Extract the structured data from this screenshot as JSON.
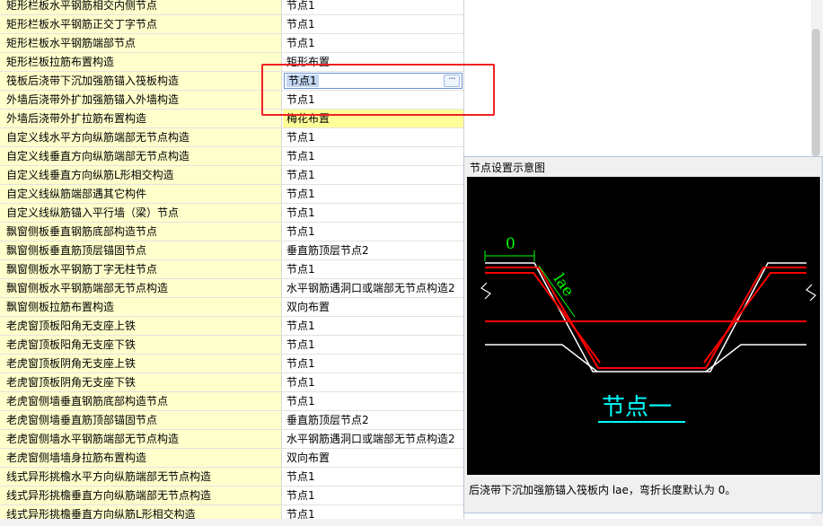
{
  "rows": [
    {
      "name": "矩形栏板水平钢筋相交内侧节点",
      "value": "节点1"
    },
    {
      "name": "矩形栏板水平钢筋正交丁字节点",
      "value": "节点1"
    },
    {
      "name": "矩形栏板水平钢筋端部节点",
      "value": "节点1"
    },
    {
      "name": "矩形栏板拉筋布置构造",
      "value": "矩形布置"
    },
    {
      "name": "筏板后浇带下沉加强筋锚入筏板构造",
      "value": "节点1"
    },
    {
      "name": "外墙后浇带外扩加强筋锚入外墙构造",
      "value": "节点1"
    },
    {
      "name": "外墙后浇带外扩拉筋布置构造",
      "value": "梅花布置"
    },
    {
      "name": "自定义线水平方向纵筋端部无节点构造",
      "value": "节点1"
    },
    {
      "name": "自定义线垂直方向纵筋端部无节点构造",
      "value": "节点1"
    },
    {
      "name": "自定义线垂直方向纵筋L形相交构造",
      "value": "节点1"
    },
    {
      "name": "自定义线纵筋端部遇其它构件",
      "value": "节点1"
    },
    {
      "name": "自定义线纵筋锚入平行墙（梁）节点",
      "value": "节点1"
    },
    {
      "name": "飘窗侧板垂直钢筋底部构造节点",
      "value": "节点1"
    },
    {
      "name": "飘窗侧板垂直筋顶层锚固节点",
      "value": "垂直筋顶层节点2"
    },
    {
      "name": "飘窗侧板水平钢筋丁字无柱节点",
      "value": "节点1"
    },
    {
      "name": "飘窗侧板水平钢筋端部无节点构造",
      "value": "水平钢筋遇洞口或端部无节点构造2"
    },
    {
      "name": "飘窗侧板拉筋布置构造",
      "value": "双向布置"
    },
    {
      "name": "老虎窗顶板阳角无支座上铁",
      "value": "节点1"
    },
    {
      "name": "老虎窗顶板阳角无支座下铁",
      "value": "节点1"
    },
    {
      "name": "老虎窗顶板阴角无支座上铁",
      "value": "节点1"
    },
    {
      "name": "老虎窗顶板阴角无支座下铁",
      "value": "节点1"
    },
    {
      "name": "老虎窗侧墙垂直钢筋底部构造节点",
      "value": "节点1"
    },
    {
      "name": "老虎窗侧墙垂直筋顶部锚固节点",
      "value": "垂直筋顶层节点2"
    },
    {
      "name": "老虎窗侧墙水平钢筋端部无节点构造",
      "value": "水平钢筋遇洞口或端部无节点构造2"
    },
    {
      "name": "老虎窗侧墙墙身拉筋布置构造",
      "value": "双向布置"
    },
    {
      "name": "线式异形挑檐水平方向纵筋端部无节点构造",
      "value": "节点1"
    },
    {
      "name": "线式异形挑檐垂直方向纵筋端部无节点构造",
      "value": "节点1"
    },
    {
      "name": "线式异形挑檐垂直方向纵筋L形相交构造",
      "value": "节点1"
    }
  ],
  "selected_row": 4,
  "ellipsis_label": "···",
  "panel": {
    "title": "节点设置示意图",
    "caption": "后浇带下沉加强筋锚入筏板内 lae，弯折长度默认为 0。",
    "diagram": {
      "dim_zero": "0",
      "dim_lae": "lae",
      "node_label": "节点一"
    }
  },
  "colors": {
    "annotation": "#ee2222",
    "name_cell_bg": "#ffffcc",
    "highlight_value_bg": "#ffff99",
    "rebar": "#ff0000",
    "concrete_outline": "#ffffff",
    "dimension": "#00ff00",
    "node_label": "#00ffff"
  }
}
